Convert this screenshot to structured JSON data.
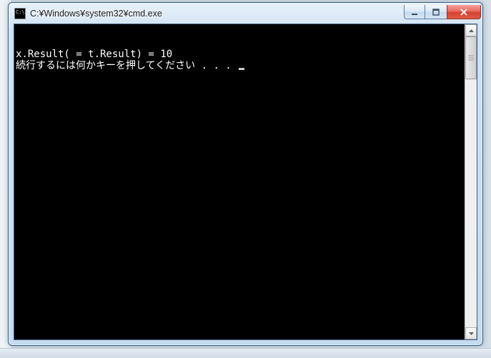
{
  "window": {
    "title": "C:¥Windows¥system32¥cmd.exe"
  },
  "console": {
    "line1": "x.Result( = t.Result) = 10",
    "line2": "続行するには何かキーを押してください . . . "
  },
  "statusbar": {
    "text": ""
  }
}
